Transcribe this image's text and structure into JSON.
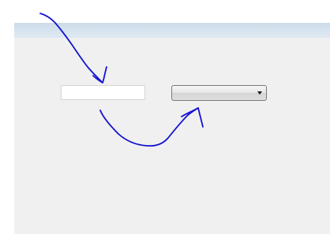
{
  "form": {
    "text_field_value": "",
    "dropdown_selected": ""
  },
  "annotations": {
    "color": "#1414d2"
  }
}
